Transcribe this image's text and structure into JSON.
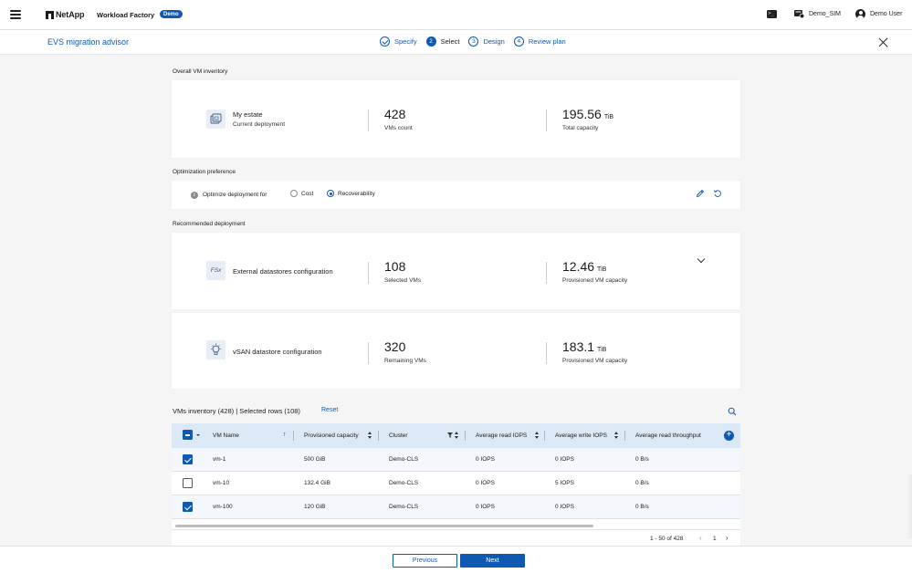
{
  "topbar": {
    "brand": "NetApp",
    "product": "Workload Factory",
    "badge": "Demo",
    "workspace": "Demo_SIM",
    "user": "Demo User"
  },
  "subheader": {
    "title": "EVS migration advisor",
    "steps": [
      {
        "num": "1",
        "label": "Specify",
        "state": "done"
      },
      {
        "num": "2",
        "label": "Select",
        "state": "active"
      },
      {
        "num": "3",
        "label": "Design",
        "state": "todo"
      },
      {
        "num": "4",
        "label": "Review plan",
        "state": "todo"
      }
    ]
  },
  "inventory": {
    "section_title": "Overall VM inventory",
    "name": "My estate",
    "sub": "Current deployment",
    "m1_value": "428",
    "m1_label": "VMs count",
    "m2_value": "195.56",
    "m2_unit": "TiB",
    "m2_label": "Total capacity"
  },
  "optimization": {
    "section_title": "Optimization preference",
    "info": "i",
    "label": "Optimize deployment for",
    "options": [
      "Cost",
      "Recoverability"
    ],
    "selected": "Recoverability"
  },
  "recommended": {
    "section_title": "Recommended deployment",
    "external": {
      "icon_text": "FSx",
      "name": "External datastores configuration",
      "m1_value": "108",
      "m1_label": "Selected VMs",
      "m2_value": "12.46",
      "m2_unit": "TiB",
      "m2_label": "Provisioned VM capacity"
    },
    "vsan": {
      "name": "vSAN datastore configuration",
      "m1_value": "320",
      "m1_label": "Remaining VMs",
      "m2_value": "183.1",
      "m2_unit": "TiB",
      "m2_label": "Provisioned VM capacity"
    }
  },
  "table": {
    "title": "VMs inventory (428) | Selected rows (108)",
    "reset": "Reset",
    "add": "+",
    "sort_up": "↑",
    "columns": [
      "VM Name",
      "Provisioned capacity",
      "Cluster",
      "Average read IOPS",
      "Average write IOPS",
      "Average read throughput"
    ],
    "rows": [
      {
        "selected": true,
        "name": "vm-1",
        "capacity": "500 GiB",
        "cluster": "Demo-CLS",
        "read_iops": "0 IOPS",
        "write_iops": "0 IOPS",
        "read_tp": "0 B/s"
      },
      {
        "selected": false,
        "name": "vm-10",
        "capacity": "132.4 GiB",
        "cluster": "Demo-CLS",
        "read_iops": "0 IOPS",
        "write_iops": "5 IOPS",
        "read_tp": "0 B/s"
      },
      {
        "selected": true,
        "name": "vm-100",
        "capacity": "120 GiB",
        "cluster": "Demo-CLS",
        "read_iops": "0 IOPS",
        "write_iops": "0 IOPS",
        "read_tp": "0 B/s"
      }
    ],
    "pager": {
      "range": "1 - 50 of 428",
      "page": "1",
      "prev": "‹",
      "next": "›"
    }
  },
  "footer": {
    "previous": "Previous",
    "next": "Next"
  },
  "colors": {
    "accent": "#0f59b3",
    "header_bg": "#dbe8f5",
    "page_bg": "#f5f5f5"
  }
}
